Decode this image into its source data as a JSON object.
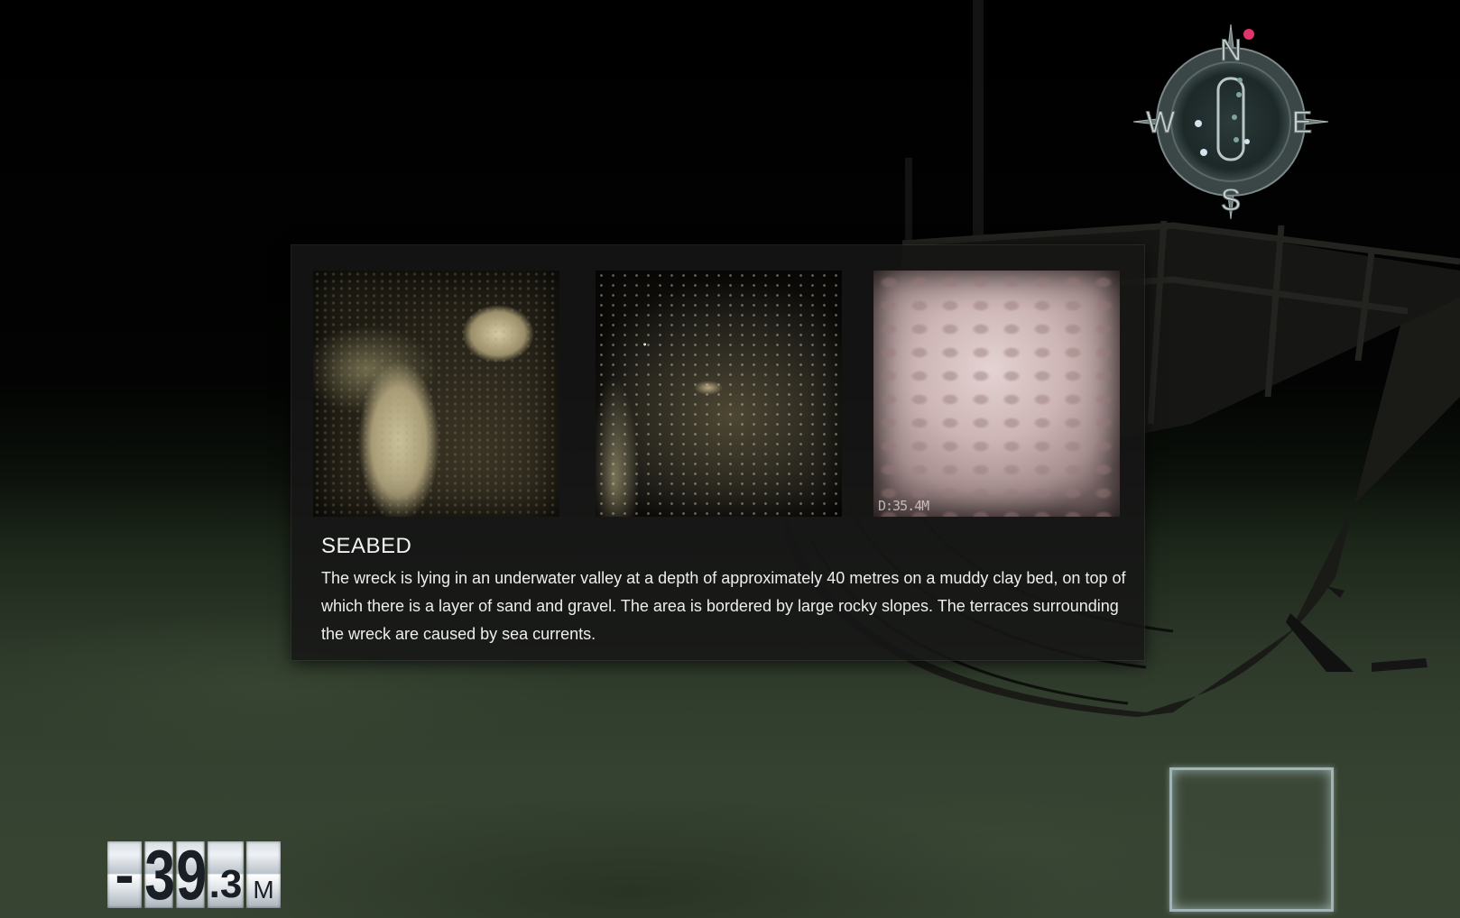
{
  "info": {
    "title": "SEABED",
    "body": "The wreck is lying in an underwater valley at a depth of approximately 40 metres on a muddy clay bed, on top of which there is a layer of sand and gravel. The area is bordered by large rocky slopes. The terraces surrounding the wreck are caused by sea currents.",
    "photo_stamp": "D:35.4M"
  },
  "compass": {
    "north": "N",
    "east": "E",
    "south": "S",
    "west": "W",
    "accent_color": "#e0356a"
  },
  "depth": {
    "sign": "-",
    "tens": "3",
    "units": "9",
    "decimal": ".3",
    "unit": "M",
    "value": -39.3
  },
  "colors": {
    "panel_bg": "#161616",
    "text": "#eeeeee"
  }
}
